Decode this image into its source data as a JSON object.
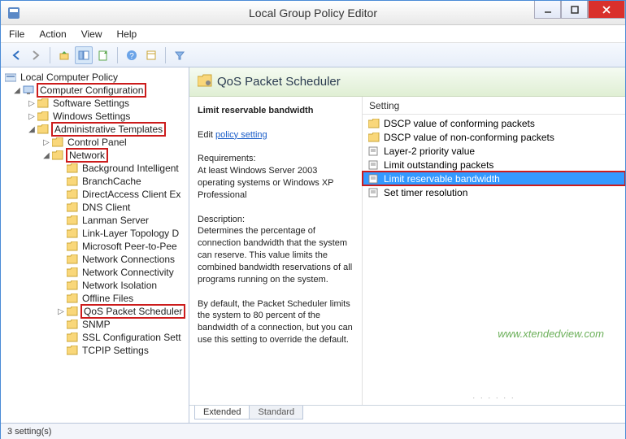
{
  "title": "Local Group Policy Editor",
  "menu": {
    "file": "File",
    "action": "Action",
    "view": "View",
    "help": "Help"
  },
  "tree": {
    "root": "Local Computer Policy",
    "cc": "Computer Configuration",
    "ss": "Software Settings",
    "ws": "Windows Settings",
    "at": "Administrative Templates",
    "cp": "Control Panel",
    "net": "Network",
    "items": {
      "bgi": "Background Intelligent",
      "bc": "BranchCache",
      "dace": "DirectAccess Client Ex",
      "dns": "DNS Client",
      "ls": "Lanman Server",
      "llt": "Link-Layer Topology D",
      "mpp": "Microsoft Peer-to-Pee",
      "ncon": "Network Connections",
      "ncty": "Network Connectivity",
      "niso": "Network Isolation",
      "off": "Offline Files",
      "qos": "QoS Packet Scheduler",
      "snmp": "SNMP",
      "ssl": "SSL Configuration Sett",
      "tcpip": "TCPIP Settings"
    }
  },
  "content": {
    "header": "QoS Packet Scheduler",
    "setting_title": "Limit reservable bandwidth",
    "edit_prefix": "Edit",
    "edit_link": "policy setting",
    "req_label": "Requirements:",
    "req_text": "At least Windows Server 2003 operating systems or Windows XP Professional",
    "desc_label": "Description:",
    "desc_text1": "Determines the percentage of connection bandwidth that the system can reserve. This value limits the combined bandwidth reservations of all programs running on the system.",
    "desc_text2": "By default, the Packet Scheduler limits the system to 80 percent of the bandwidth of a connection, but you can use this setting to override the default."
  },
  "list": {
    "header": "Setting",
    "rows": {
      "r0": "DSCP value of conforming packets",
      "r1": "DSCP value of non-conforming packets",
      "r2": "Layer-2 priority value",
      "r3": "Limit outstanding packets",
      "r4": "Limit reservable bandwidth",
      "r5": "Set timer resolution"
    }
  },
  "tabs": {
    "extended": "Extended",
    "standard": "Standard"
  },
  "status": "3 setting(s)",
  "watermark": "www.xtendedview.com"
}
